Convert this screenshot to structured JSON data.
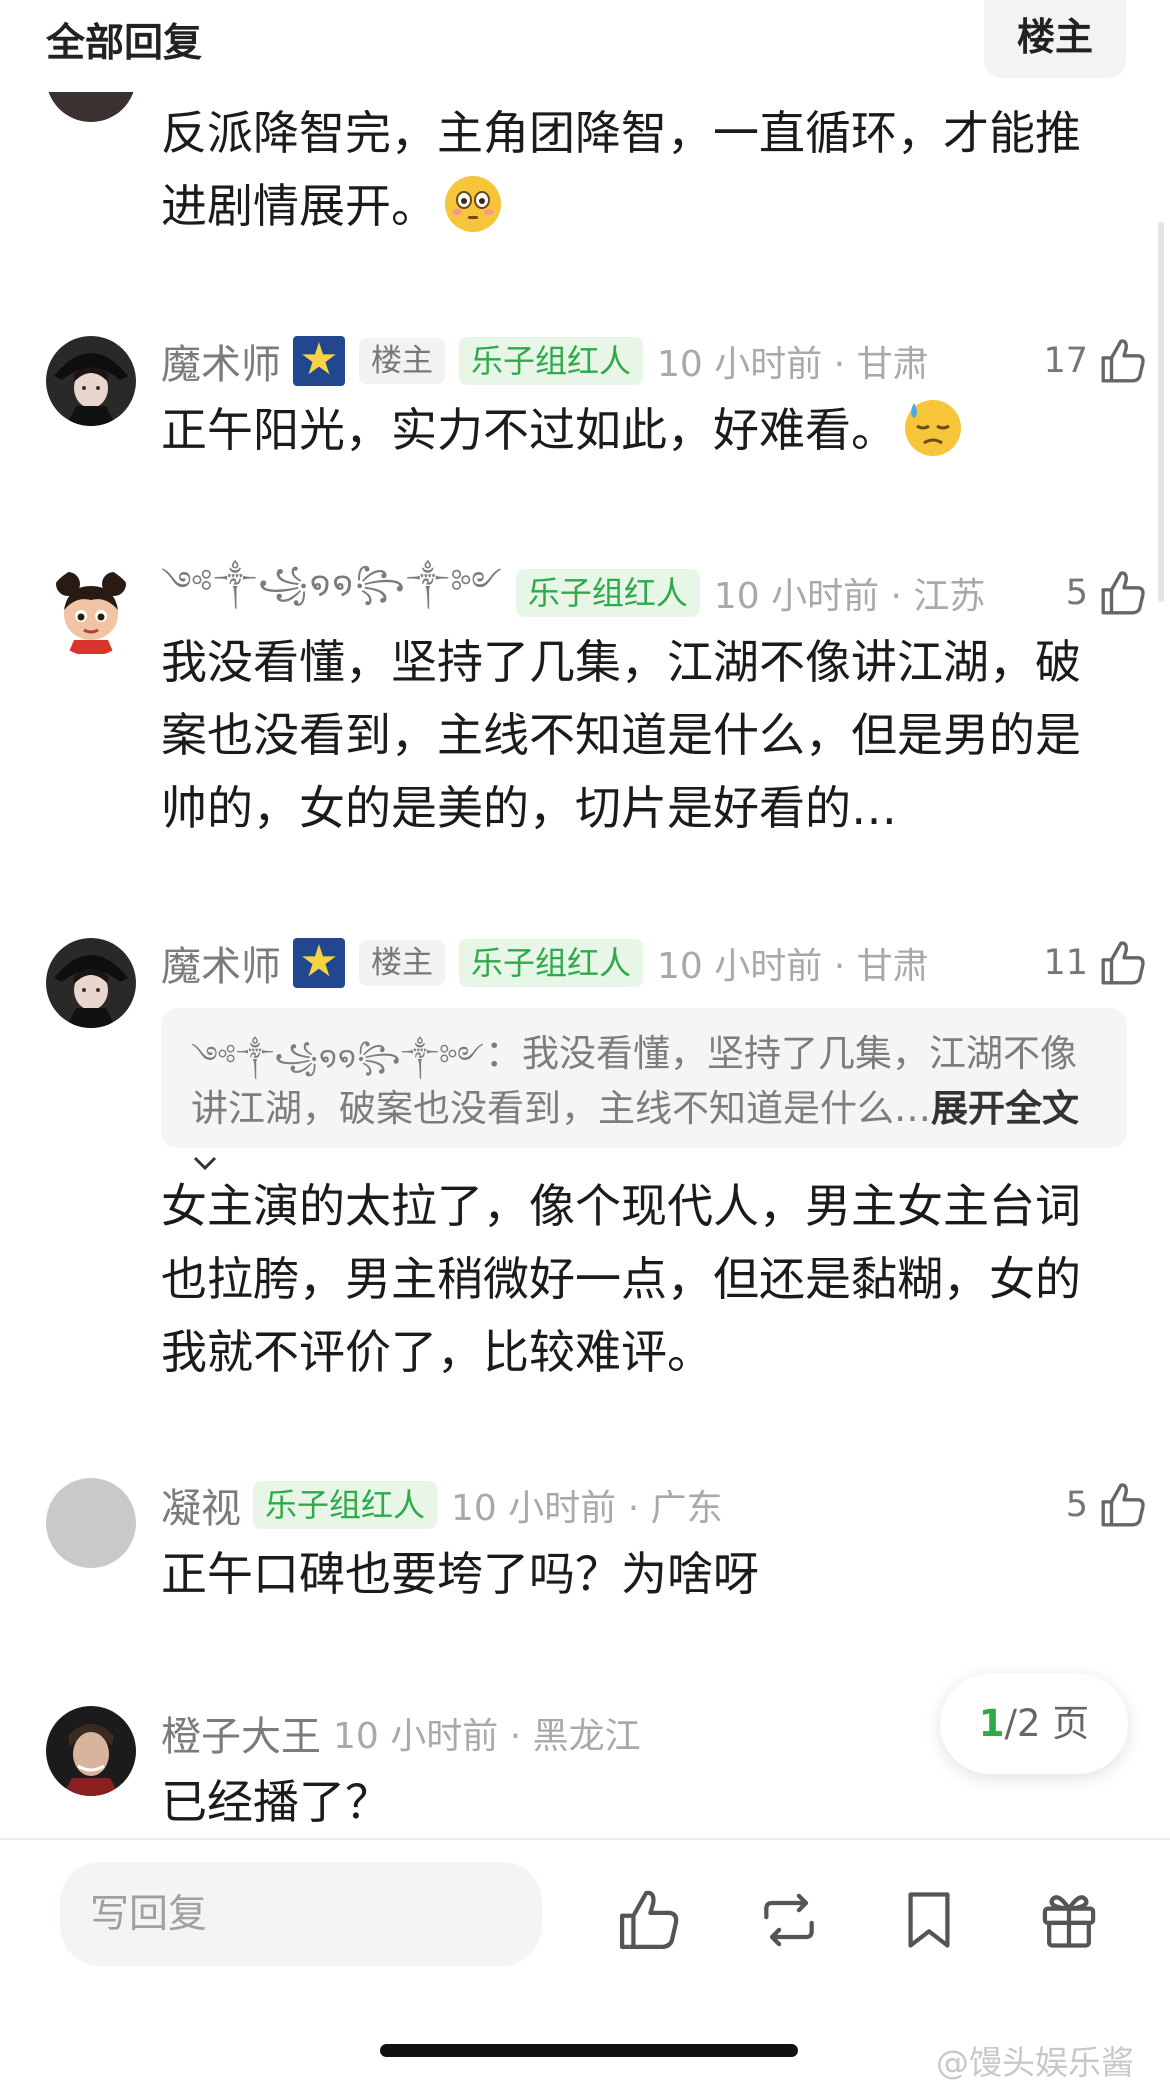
{
  "header": {
    "title": "全部回复",
    "owner_button": "楼主"
  },
  "comments": [
    {
      "username": "",
      "text": "反派降智完，主角团降智，一直循环，才能推进剧情展开。",
      "emoji": "flushed-face-emoji"
    },
    {
      "username": "魔术师",
      "badge_icon": "star-badge-icon",
      "owner_tag": "楼主",
      "tag": "乐子组红人",
      "time_location": "10 小时前 · 甘肃",
      "likes": "17",
      "text": "正午阳光，实力不过如此，好难看。",
      "emoji": "downcast-sweat-face-emoji"
    },
    {
      "username": "༺༒꧁໑໑꧂༒༻",
      "tag": "乐子组红人",
      "time_location": "10 小时前 · 江苏",
      "likes": "5",
      "text": "我没看懂，坚持了几集，江湖不像讲江湖，破案也没看到，主线不知道是什么，但是男的是帅的，女的是美的，切片是好看的…"
    },
    {
      "username": "魔术师",
      "badge_icon": "star-badge-icon",
      "owner_tag": "楼主",
      "tag": "乐子组红人",
      "time_location": "10 小时前 · 甘肃",
      "likes": "11",
      "quote": {
        "author": "༺༒꧁໑໑꧂༒༻",
        "text": "我没看懂，坚持了几集，江湖不像讲江湖，破案也没看到，主线不知道是什么…",
        "expand_label": "展开全文"
      },
      "text": "女主演的太拉了，像个现代人，男主女主台词也拉胯，男主稍微好一点，但还是黏糊，女的我就不评价了，比较难评。"
    },
    {
      "username": "凝视",
      "tag": "乐子组红人",
      "time_location": "10 小时前 · 广东",
      "likes": "5",
      "text": "正午口碑也要垮了吗？为啥呀"
    },
    {
      "username": "橙子大王",
      "time_location": "10 小时前 · 黑龙江",
      "text": "已经播了？"
    }
  ],
  "pager": {
    "current": "1",
    "total_label": "/2 页"
  },
  "bottom_bar": {
    "reply_placeholder": "写回复",
    "icons": [
      "thumbs-up-icon",
      "repost-icon",
      "bookmark-icon",
      "gift-icon"
    ]
  },
  "watermark": "@馒头娱乐酱",
  "colors": {
    "accent_green": "#2fa94a",
    "tag_green_bg": "#e7f6e7",
    "muted_text": "#a9a9a9"
  }
}
